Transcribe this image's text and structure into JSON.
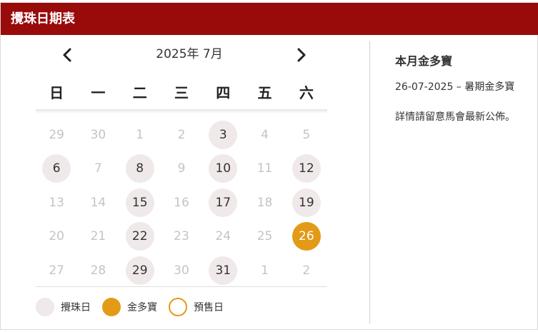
{
  "header": {
    "title": "攪珠日期表"
  },
  "calendar": {
    "month_label": "2025年 7月",
    "prev_icon": "chevron-left-icon",
    "next_icon": "chevron-right-icon",
    "weekdays": [
      "日",
      "一",
      "二",
      "三",
      "四",
      "五",
      "六"
    ],
    "weeks": [
      [
        {
          "day": "29",
          "type": "other"
        },
        {
          "day": "30",
          "type": "other"
        },
        {
          "day": "1",
          "type": "none"
        },
        {
          "day": "2",
          "type": "none"
        },
        {
          "day": "3",
          "type": "draw"
        },
        {
          "day": "4",
          "type": "none"
        },
        {
          "day": "5",
          "type": "none"
        }
      ],
      [
        {
          "day": "6",
          "type": "draw"
        },
        {
          "day": "7",
          "type": "none"
        },
        {
          "day": "8",
          "type": "draw"
        },
        {
          "day": "9",
          "type": "none"
        },
        {
          "day": "10",
          "type": "draw"
        },
        {
          "day": "11",
          "type": "none"
        },
        {
          "day": "12",
          "type": "draw"
        }
      ],
      [
        {
          "day": "13",
          "type": "none"
        },
        {
          "day": "14",
          "type": "none"
        },
        {
          "day": "15",
          "type": "draw"
        },
        {
          "day": "16",
          "type": "none"
        },
        {
          "day": "17",
          "type": "draw"
        },
        {
          "day": "18",
          "type": "none"
        },
        {
          "day": "19",
          "type": "draw"
        }
      ],
      [
        {
          "day": "20",
          "type": "none"
        },
        {
          "day": "21",
          "type": "none"
        },
        {
          "day": "22",
          "type": "draw"
        },
        {
          "day": "23",
          "type": "none"
        },
        {
          "day": "24",
          "type": "none"
        },
        {
          "day": "25",
          "type": "none"
        },
        {
          "day": "26",
          "type": "jackpot"
        }
      ],
      [
        {
          "day": "27",
          "type": "none"
        },
        {
          "day": "28",
          "type": "none"
        },
        {
          "day": "29",
          "type": "draw"
        },
        {
          "day": "30",
          "type": "none"
        },
        {
          "day": "31",
          "type": "draw"
        },
        {
          "day": "1",
          "type": "other"
        },
        {
          "day": "2",
          "type": "other"
        }
      ]
    ]
  },
  "legend": {
    "draw": "攪珠日",
    "jackpot": "金多寶",
    "presale": "預售日"
  },
  "info": {
    "title": "本月金多寶",
    "entry": "26-07-2025 – 暑期金多寶",
    "note": "詳情請留意馬會最新公佈。"
  },
  "colors": {
    "brand": "#990b0b",
    "draw_day": "#efe9ea",
    "jackpot": "#e39a16"
  }
}
